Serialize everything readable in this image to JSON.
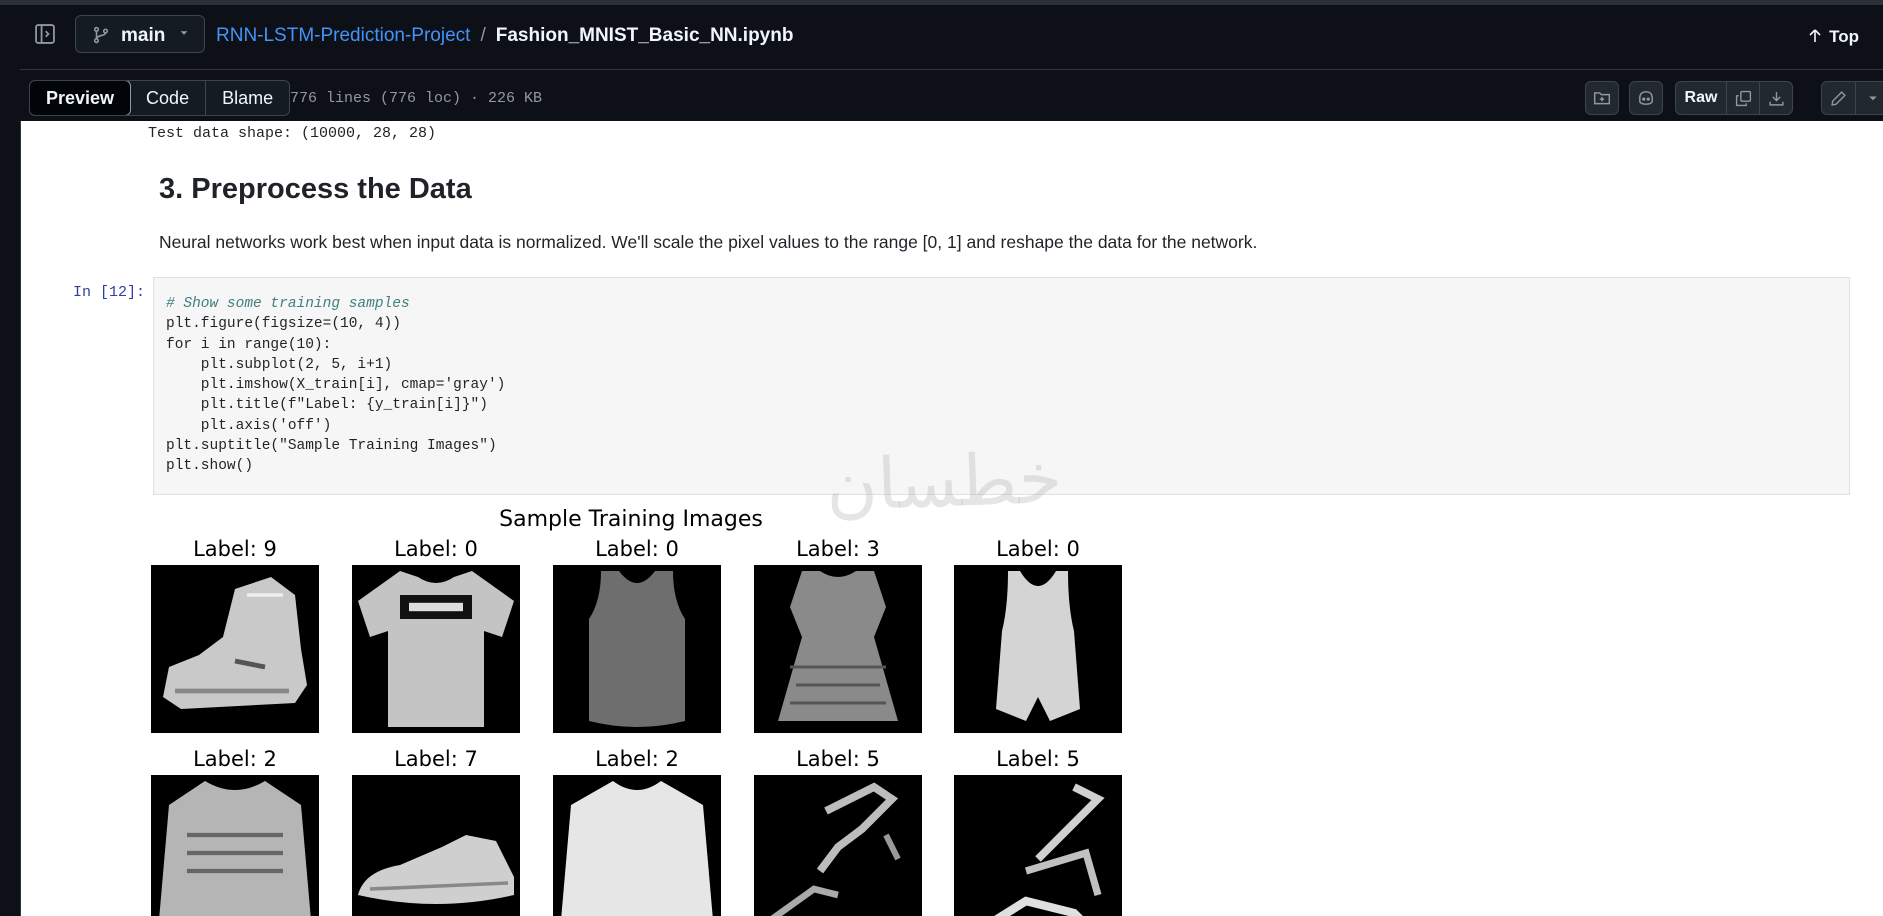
{
  "header": {
    "branch": "main",
    "repo": "RNN-LSTM-Prediction-Project",
    "separator": "/",
    "file": "Fashion_MNIST_Basic_NN.ipynb",
    "top_label": "Top"
  },
  "toolbar": {
    "tabs": [
      "Preview",
      "Code",
      "Blame"
    ],
    "active_tab": "Preview",
    "file_info": "776 lines (776 loc) · 226 KB",
    "raw_label": "Raw"
  },
  "notebook": {
    "prev_output": "Test data shape: (10000, 28, 28)",
    "section_heading": "3. Preprocess the Data",
    "paragraph": "Neural networks work best when input data is normalized. We'll scale the pixel values to the range [0, 1] and reshape the data for the network.",
    "cell_prompt": "In [12]:",
    "code_lines": [
      "# Show some training samples",
      "plt.figure(figsize=(10, 4))",
      "for i in range(10):",
      "    plt.subplot(2, 5, i+1)",
      "    plt.imshow(X_train[i], cmap='gray')",
      "    plt.title(f\"Label: {y_train[i]}\")",
      "    plt.axis('off')",
      "plt.suptitle(\"Sample Training Images\")",
      "plt.show()"
    ],
    "figure": {
      "suptitle": "Sample Training Images",
      "labels": [
        "Label: 9",
        "Label: 0",
        "Label: 0",
        "Label: 3",
        "Label: 0",
        "Label: 2",
        "Label: 7",
        "Label: 2",
        "Label: 5",
        "Label: 5"
      ],
      "items": [
        "ankle-boot",
        "t-shirt",
        "tank-top",
        "dress",
        "tank-top",
        "pullover",
        "sneaker",
        "pullover",
        "sandal",
        "sandal"
      ]
    },
    "watermark": "خطسان"
  },
  "colors": {
    "header_bg": "#0d1117",
    "link": "#4493f8",
    "notebook_bg": "#ffffff",
    "code_bg": "#f6f6f6",
    "prompt": "#303f9f"
  }
}
